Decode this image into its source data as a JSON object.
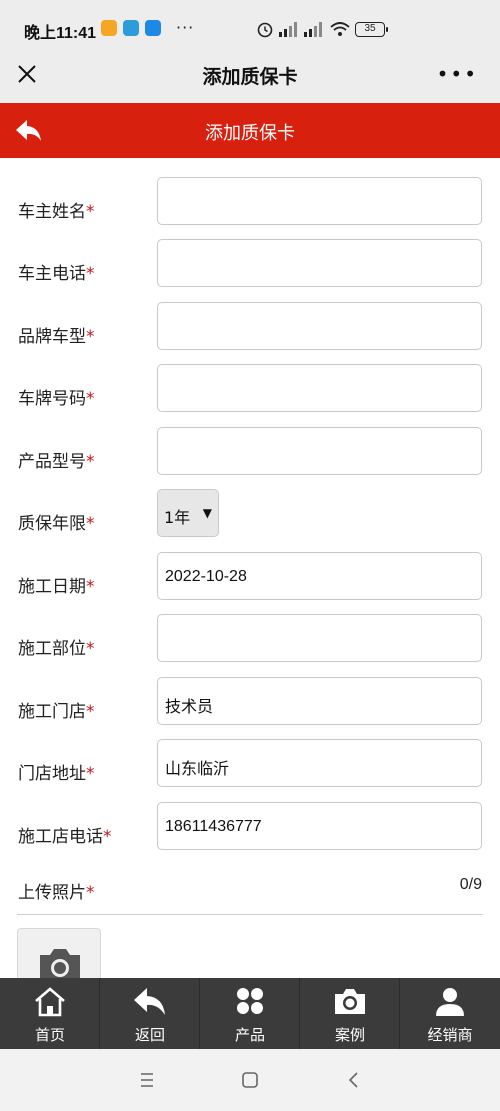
{
  "status_bar": {
    "time": "晚上11:41",
    "more": "···",
    "battery": "35"
  },
  "wechat_header": {
    "title": "添加质保卡",
    "more": "•••"
  },
  "page_header": {
    "title": "添加质保卡"
  },
  "form": {
    "required_mark": "*",
    "fields": [
      {
        "label": "车主姓名",
        "value": ""
      },
      {
        "label": "车主电话",
        "value": ""
      },
      {
        "label": "品牌车型",
        "value": ""
      },
      {
        "label": "车牌号码",
        "value": ""
      },
      {
        "label": "产品型号",
        "value": ""
      },
      {
        "label": "质保年限",
        "value": "1年"
      },
      {
        "label": "施工日期",
        "value": "2022-10-28"
      },
      {
        "label": "施工部位",
        "value": ""
      },
      {
        "label": "施工门店",
        "value": "技术员"
      },
      {
        "label": "门店地址",
        "value": "山东临沂"
      },
      {
        "label": "施工店电话",
        "value": "18611436777"
      }
    ],
    "upload": {
      "label": "上传照片",
      "count": "0/9"
    }
  },
  "tab_bar": {
    "items": [
      {
        "label": "首页",
        "icon": "home-icon"
      },
      {
        "label": "返回",
        "icon": "back-icon"
      },
      {
        "label": "产品",
        "icon": "grid-icon"
      },
      {
        "label": "案例",
        "icon": "camera-icon"
      },
      {
        "label": "经销商",
        "icon": "user-icon"
      }
    ]
  },
  "colors": {
    "header_red": "#d7200d",
    "required_red": "#c1191d",
    "tab_bar": "#3b3b3b"
  }
}
